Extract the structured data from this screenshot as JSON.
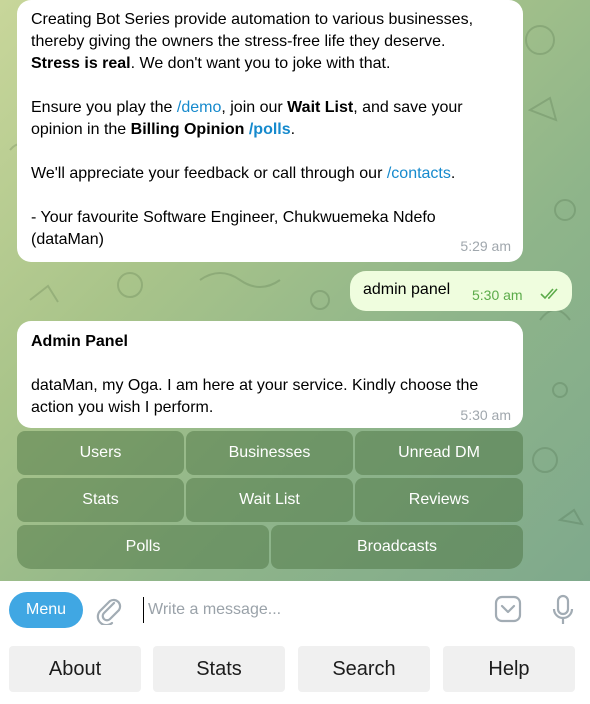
{
  "messages": {
    "intro": {
      "line1": "Creating Bot Series provide automation to various businesses,",
      "line2": "thereby giving the owners the stress-free life they deserve.",
      "line3_bold": "Stress is real",
      "line3_rest": ". We don't want you to joke with that.",
      "l5_a": "Ensure you play the ",
      "l5_link": "/demo",
      "l5_b": ", join our ",
      "l5_bold": "Wait List",
      "l5_c": ", and save your",
      "l6_a": "opinion in the ",
      "l6_bold": "Billing Opinion",
      "l6_sp": " ",
      "l6_link": "/polls",
      "l6_b": ".",
      "l8_a": "We'll appreciate your feedback or call through our ",
      "l8_link": "/contacts",
      "l8_b": ".",
      "l10": "- Your favourite Software Engineer, Chukwuemeka Ndefo",
      "l11": "(dataMan)",
      "time": "5:29 am"
    },
    "outgoing": {
      "text": "admin panel",
      "time": "5:30 am"
    },
    "admin": {
      "title": "Admin Panel",
      "line1": "dataMan, my Oga. I am here at your service. Kindly choose the",
      "line2": "action you wish I perform.",
      "time": "5:30 am"
    }
  },
  "inline_keyboard": {
    "users": "Users",
    "businesses": "Businesses",
    "unread_dm": "Unread DM",
    "stats": "Stats",
    "wait_list": "Wait List",
    "reviews": "Reviews",
    "polls": "Polls",
    "broadcasts": "Broadcasts"
  },
  "composer": {
    "menu_label": "Menu",
    "placeholder": "Write a message..."
  },
  "reply_keyboard": {
    "about": "About",
    "stats": "Stats",
    "search": "Search",
    "help": "Help"
  },
  "colors": {
    "accent": "#40a7e3",
    "link": "#168acd",
    "outgoing_bubble": "#effdde",
    "check_green": "#5cab4a"
  }
}
